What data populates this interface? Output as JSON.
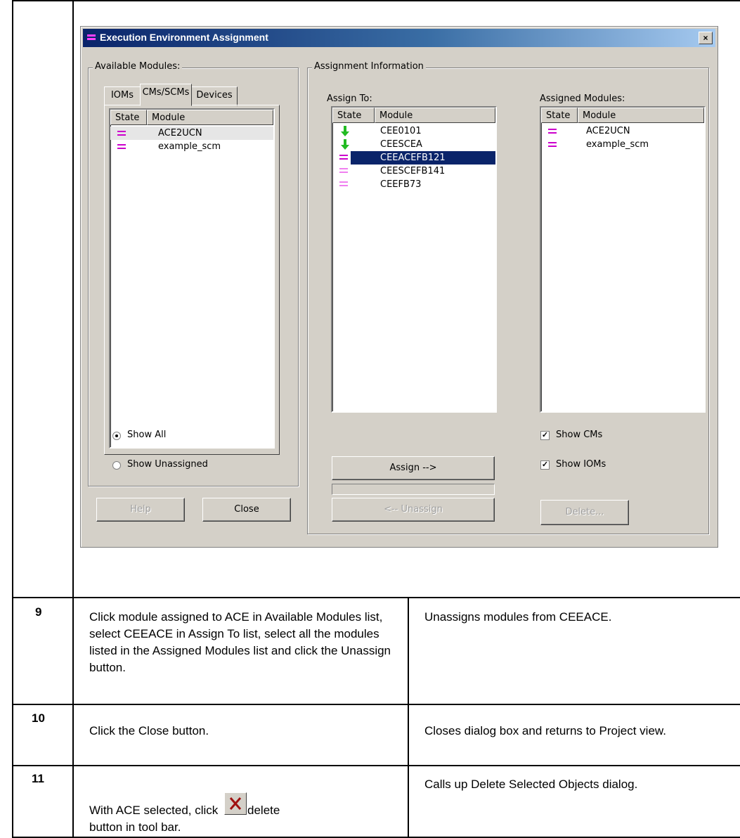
{
  "dialog": {
    "title": "Execution Environment Assignment",
    "close_glyph": "×",
    "available_modules": {
      "legend": "Available Modules:",
      "tabs": [
        "IOMs",
        "CMs/SCMs",
        "Devices"
      ],
      "active_tab": "CMs/SCMs",
      "columns": [
        "State",
        "Module"
      ],
      "rows": [
        "ACE2UCN",
        "example_scm"
      ],
      "radio_show_all": "Show All",
      "radio_show_unassigned": "Show Unassigned",
      "selected_radio": "Show All"
    },
    "assignment_information": {
      "legend": "Assignment Information",
      "assign_to_label": "Assign To:",
      "assigned_modules_label": "Assigned Modules:",
      "columns": [
        "State",
        "Module"
      ],
      "assign_to_rows": [
        "CEE0101",
        "CEESCEA",
        "CEEACEFB121",
        "CEESCEFB141",
        "CEEFB73"
      ],
      "selected_row": "CEEACEFB121",
      "assigned_rows": [
        "ACE2UCN",
        "example_scm"
      ],
      "show_cms": "Show CMs",
      "show_ioms": "Show IOMs"
    },
    "buttons": {
      "help": "Help",
      "close": "Close",
      "assign": "Assign -->",
      "unassign": "<-- Unassign",
      "delete": "Delete..."
    }
  },
  "steps": [
    {
      "number": "9",
      "action": "Click module assigned to ACE in Available Modules list, select CEEACE in Assign To list, select all the modules listed in the Assigned Modules list and click the Unassign button.",
      "result": "Unassigns modules from CEEACE."
    },
    {
      "number": "10",
      "action": "Click the Close button.",
      "result": "Closes dialog box and returns to Project view."
    },
    {
      "number": "11",
      "action_before": "With ACE selected, click",
      "action_after": "delete",
      "action_line2": "button in tool bar.",
      "result": "Calls up Delete Selected Objects dialog."
    }
  ],
  "colors": {
    "title_bar": "#0a246a",
    "selection": "#0a246a",
    "state_icon_magenta": "#cc00cc",
    "arrow_green": "#22bb22",
    "delete_x_red": "#a01010"
  }
}
